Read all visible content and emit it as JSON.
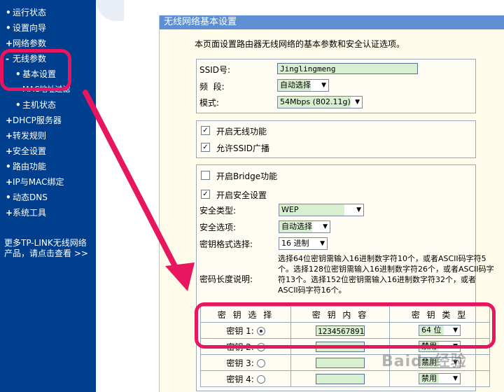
{
  "sidebar": {
    "items": [
      {
        "label": "运行状态",
        "bullet": "•"
      },
      {
        "label": "设置向导",
        "bullet": "•"
      },
      {
        "label": "网络参数",
        "bullet": "+"
      },
      {
        "label": "无线参数",
        "bullet": "-"
      },
      {
        "label": "基本设置",
        "bullet": "•"
      },
      {
        "label": "MAC地址过滤",
        "bullet": "•"
      },
      {
        "label": "主机状态",
        "bullet": "•"
      },
      {
        "label": "DHCP服务器",
        "bullet": "+"
      },
      {
        "label": "转发规则",
        "bullet": "+"
      },
      {
        "label": "安全设置",
        "bullet": "+"
      },
      {
        "label": "路由功能",
        "bullet": "•"
      },
      {
        "label": "IP与MAC绑定",
        "bullet": "+"
      },
      {
        "label": "动态DNS",
        "bullet": "•"
      },
      {
        "label": "系统工具",
        "bullet": "+"
      }
    ],
    "more_text": "更多TP-LINK无线网络产品，请点击查看 >>"
  },
  "panel": {
    "title": "无线网络基本设置",
    "intro": "本页面设置路由器无线网络的基本参数和安全认证选项。"
  },
  "basic": {
    "ssid_label": "SSID号:",
    "ssid_value": "Jinglingmeng",
    "channel_label": "频  段:",
    "channel_value": "自动选择",
    "mode_label": "模式:",
    "mode_value": "54Mbps (802.11g)"
  },
  "wireless": {
    "enable_label": "开启无线功能",
    "broadcast_label": "允许SSID广播"
  },
  "security": {
    "bridge_label": "开启Bridge功能",
    "enable_security_label": "开启安全设置",
    "type_label": "安全类型:",
    "type_value": "WEP",
    "option_label": "安全选项:",
    "option_value": "自动选择",
    "format_label": "密钥格式选择:",
    "format_value": "16 进制",
    "length_label": "密码长度说明:",
    "length_desc": "选择64位密钥需输入16进制数字符10个，或者ASCII码字符5个。选择128位密钥需输入16进制数字符26个，或者ASCII码字符13个。选择152位密钥需输入16进制数字符32个，或者ASCII码字符16个。"
  },
  "key_table": {
    "headers": [
      "密 钥 选 择",
      "密 钥 内 容",
      "密 钥 类 型"
    ],
    "rows": [
      {
        "label": "密钥 1:",
        "value": "1234567891",
        "type": "64 位"
      },
      {
        "label": "密钥 2:",
        "value": "",
        "type": "禁用"
      },
      {
        "label": "密钥 3:",
        "value": "",
        "type": "禁用"
      },
      {
        "label": "密钥 4:",
        "value": "",
        "type": "禁用"
      }
    ]
  },
  "watermark": "Baidu经验",
  "colors": {
    "sidebar": "#003f8e",
    "header": "#5d8fd2",
    "annotation": "#e8155f",
    "input_bg": "#d8f0d0"
  }
}
